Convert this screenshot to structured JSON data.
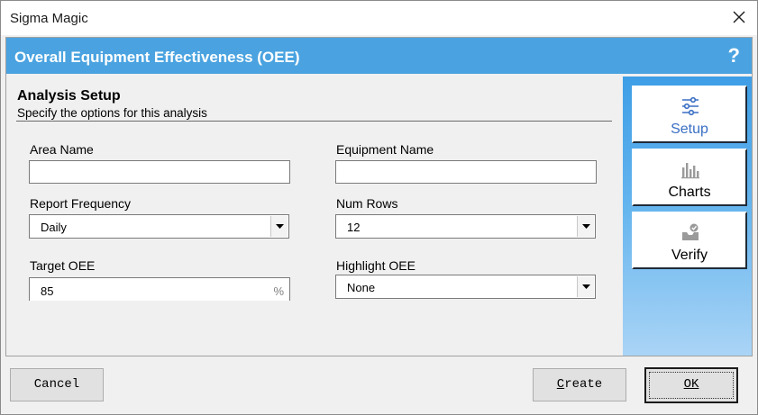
{
  "window": {
    "title": "Sigma Magic",
    "close_icon": "close-icon"
  },
  "header": {
    "title": "Overall Equipment Effectiveness (OEE)",
    "help": "?"
  },
  "section": {
    "title": "Analysis Setup",
    "subtitle": "Specify the options for this analysis"
  },
  "form": {
    "area_name": {
      "label": "Area Name",
      "value": ""
    },
    "equipment_name": {
      "label": "Equipment Name",
      "value": ""
    },
    "report_frequency": {
      "label": "Report Frequency",
      "value": "Daily"
    },
    "num_rows": {
      "label": "Num Rows",
      "value": "12"
    },
    "target_oee": {
      "label": "Target OEE",
      "value": "85",
      "unit": "%"
    },
    "highlight_oee": {
      "label": "Highlight OEE",
      "value": "None"
    }
  },
  "sidebar": {
    "items": [
      {
        "label": "Setup",
        "icon": "sliders-icon",
        "active": true
      },
      {
        "label": "Charts",
        "icon": "bar-chart-icon",
        "active": false
      },
      {
        "label": "Verify",
        "icon": "verify-icon",
        "active": false
      }
    ]
  },
  "footer": {
    "cancel": "Cancel",
    "create_first": "C",
    "create_rest": "reate",
    "ok": "OK"
  },
  "colors": {
    "banner": "#4aa3e0",
    "active_nav_text": "#3a6fc4"
  }
}
